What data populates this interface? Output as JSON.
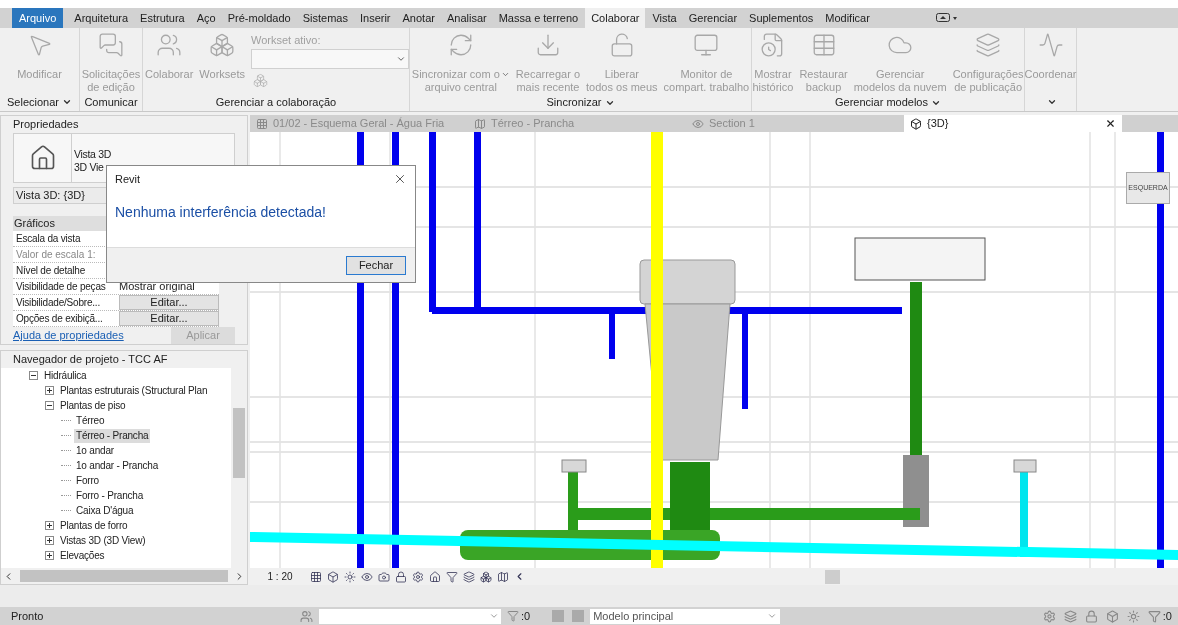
{
  "menu_tabs": [
    {
      "label": "Arquivo",
      "kind": "file",
      "selected": false
    },
    {
      "label": "Arquitetura",
      "kind": "tab",
      "selected": false
    },
    {
      "label": "Estrutura",
      "kind": "tab",
      "selected": false
    },
    {
      "label": "Aço",
      "kind": "tab",
      "selected": false
    },
    {
      "label": "Pré-moldado",
      "kind": "tab",
      "selected": false
    },
    {
      "label": "Sistemas",
      "kind": "tab",
      "selected": false
    },
    {
      "label": "Inserir",
      "kind": "tab",
      "selected": false
    },
    {
      "label": "Anotar",
      "kind": "tab",
      "selected": false
    },
    {
      "label": "Analisar",
      "kind": "tab",
      "selected": false
    },
    {
      "label": "Massa e terreno",
      "kind": "tab",
      "selected": false
    },
    {
      "label": "Colaborar",
      "kind": "tab",
      "selected": true
    },
    {
      "label": "Vista",
      "kind": "tab",
      "selected": false
    },
    {
      "label": "Gerenciar",
      "kind": "tab",
      "selected": false
    },
    {
      "label": "Suplementos",
      "kind": "tab",
      "selected": false
    },
    {
      "label": "Modificar",
      "kind": "tab",
      "selected": false
    }
  ],
  "ribbon_panels": [
    {
      "title": "Selecionar",
      "dropdown": true,
      "tools": [
        {
          "lines": [
            "Modificar"
          ],
          "dropdown": false
        }
      ]
    },
    {
      "title": "Comunicar",
      "dropdown": false,
      "tools": [
        {
          "lines": [
            "Solicitações",
            "de edição"
          ],
          "dropdown": false
        }
      ]
    },
    {
      "title": "Gerenciar a colaboração",
      "dropdown": false,
      "tools": [
        {
          "lines": [
            "Colaborar"
          ],
          "dropdown": false
        },
        {
          "lines": [
            "Worksets"
          ],
          "dropdown": false
        }
      ],
      "workset_field": {
        "label": "Workset ativo:"
      }
    },
    {
      "title": "Sincronizar",
      "dropdown": true,
      "tools": [
        {
          "lines": [
            "Sincronizar com o",
            "arquivo central"
          ],
          "dropdown": true
        },
        {
          "lines": [
            "Recarregar o",
            "mais recente"
          ],
          "dropdown": false
        },
        {
          "lines": [
            "Liberar",
            "todos os meus"
          ],
          "dropdown": false
        },
        {
          "lines": [
            "Monitor de",
            "compart. trabalho"
          ],
          "dropdown": false
        }
      ]
    },
    {
      "title": "Gerenciar modelos",
      "dropdown": true,
      "tools": [
        {
          "lines": [
            "Mostrar",
            "histórico"
          ],
          "dropdown": false
        },
        {
          "lines": [
            "Restaurar",
            "backup"
          ],
          "dropdown": false
        },
        {
          "lines": [
            "Gerenciar",
            "modelos da nuvem"
          ],
          "dropdown": false
        },
        {
          "lines": [
            "Configurações",
            "de publicação"
          ],
          "dropdown": false
        }
      ]
    },
    {
      "dropdown": true,
      "tools": [
        {
          "lines": [
            "Coordenar"
          ],
          "dropdown": false
        }
      ]
    }
  ],
  "properties": {
    "title": "Propriedades",
    "type_name": "Vista 3D",
    "type_sub": "3D Vie",
    "selector": "Vista 3D: {3D}",
    "group": "Gráficos",
    "rows": [
      {
        "label": "Escala da vista",
        "kind": "plain"
      },
      {
        "label": "Valor de escala",
        "value": "1:",
        "kind": "readonly"
      },
      {
        "label": "Nível de detalhe",
        "kind": "plain"
      },
      {
        "label": "Visibilidade de peças",
        "value": "Mostrar original",
        "kind": "plain"
      },
      {
        "label": "Visibilidade/Sobre...",
        "value": "Editar...",
        "kind": "button"
      },
      {
        "label": "Opções de exibiçã...",
        "value": "Editar...",
        "kind": "button"
      }
    ],
    "help_link": "Ajuda de propriedades",
    "apply_button": {
      "label": "Aplicar",
      "disabled": true
    }
  },
  "navigator": {
    "title": "Navegador de projeto - TCC AF",
    "tree": [
      {
        "label": "Hidráulica",
        "expanded": true,
        "selected": false,
        "children": [
          {
            "label": "Plantas estruturais (Structural Plan",
            "expanded": false,
            "selected": false
          },
          {
            "label": "Plantas de piso",
            "expanded": true,
            "selected": false,
            "children": [
              {
                "label": "Térreo",
                "selected": false
              },
              {
                "label": "Térreo - Prancha",
                "selected": true
              },
              {
                "label": "1o andar",
                "selected": false
              },
              {
                "label": "1o andar - Prancha",
                "selected": false
              },
              {
                "label": "Forro",
                "selected": false
              },
              {
                "label": "Forro - Prancha",
                "selected": false
              },
              {
                "label": "Caixa D'água",
                "selected": false
              }
            ]
          },
          {
            "label": "Plantas de forro",
            "expanded": false,
            "selected": false
          },
          {
            "label": "Vistas 3D (3D View)",
            "expanded": false,
            "selected": false
          },
          {
            "label": "Elevações",
            "expanded": false,
            "selected": false
          }
        ]
      }
    ]
  },
  "view_tabs": [
    {
      "label": "01/02 - Esquema Geral - Água Fria",
      "kind": "sheet",
      "selected": false
    },
    {
      "label": "Térreo - Prancha",
      "kind": "plan",
      "selected": false
    },
    {
      "label": "Section 1",
      "kind": "section",
      "selected": false
    },
    {
      "label": "{3D}",
      "kind": "model",
      "selected": true
    }
  ],
  "view_cube": {
    "label": "ESQUERDA"
  },
  "view_toolbar": {
    "scale": "1 : 20"
  },
  "dialog": {
    "title": "Revit",
    "message": "Nenhuma interferência detectada!",
    "button": "Fechar"
  },
  "status_bar": {
    "status": "Pronto",
    "editable_count": ":0",
    "model": "Modelo principal",
    "filter_count": ":0"
  }
}
